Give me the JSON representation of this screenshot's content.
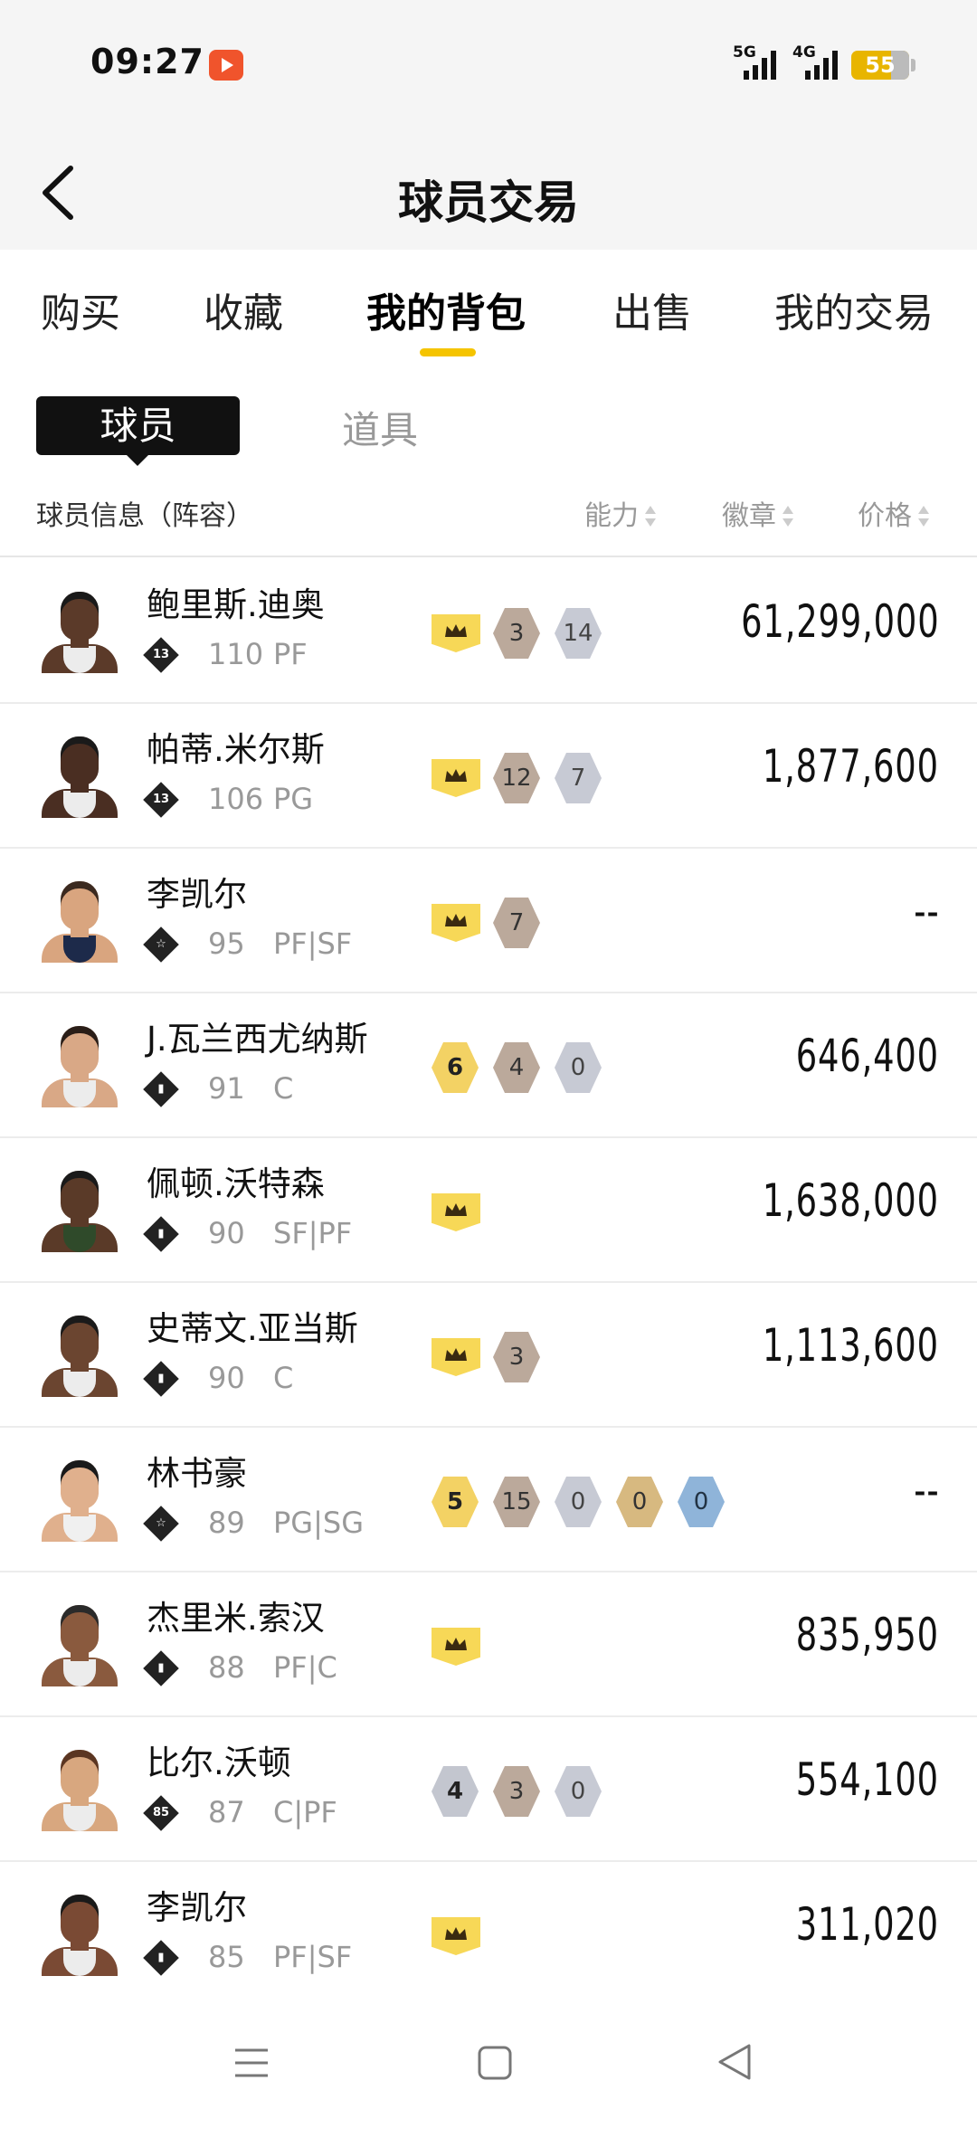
{
  "status_bar": {
    "time": "09:27",
    "sig1_label": "5G",
    "sig2_label": "4G",
    "battery": "55"
  },
  "header": {
    "title": "球员交易"
  },
  "tabs": [
    {
      "label": "购买"
    },
    {
      "label": "收藏"
    },
    {
      "label": "我的背包"
    },
    {
      "label": "出售"
    },
    {
      "label": "我的交易"
    }
  ],
  "segment": {
    "active": "球员",
    "other": "道具"
  },
  "columns": {
    "info": "球员信息（阵容）",
    "ability": "能力",
    "badge": "徽章",
    "price": "价格"
  },
  "players": [
    {
      "name": "鲍里斯.迪奥",
      "badge": "13",
      "rating": "110",
      "pos": "PF",
      "price": "61,299,000",
      "tags": [
        {
          "t": "crown",
          "v": ""
        },
        {
          "t": "bronze",
          "v": "3"
        },
        {
          "t": "silver",
          "v": "14"
        }
      ]
    },
    {
      "name": "帕蒂.米尔斯",
      "badge": "13",
      "rating": "106",
      "pos": "PG",
      "price": "1,877,600",
      "tags": [
        {
          "t": "crown",
          "v": ""
        },
        {
          "t": "bronze",
          "v": "12"
        },
        {
          "t": "silver",
          "v": "7"
        }
      ]
    },
    {
      "name": "李凯尔",
      "badge": "☆",
      "rating": "95",
      "pos": "PF|SF",
      "price": "--",
      "tags": [
        {
          "t": "crown",
          "v": ""
        },
        {
          "t": "bronze",
          "v": "7"
        }
      ]
    },
    {
      "name": "J.瓦兰西尤纳斯",
      "badge": "▮",
      "rating": "91",
      "pos": "C",
      "price": "646,400",
      "tags": [
        {
          "t": "gold",
          "v": "6"
        },
        {
          "t": "bronze",
          "v": "4"
        },
        {
          "t": "silver",
          "v": "0"
        }
      ]
    },
    {
      "name": "佩顿.沃特森",
      "badge": "▮",
      "rating": "90",
      "pos": "SF|PF",
      "price": "1,638,000",
      "tags": [
        {
          "t": "crown",
          "v": ""
        }
      ]
    },
    {
      "name": "史蒂文.亚当斯",
      "badge": "▮",
      "rating": "90",
      "pos": "C",
      "price": "1,113,600",
      "tags": [
        {
          "t": "crown",
          "v": ""
        },
        {
          "t": "bronze",
          "v": "3"
        }
      ]
    },
    {
      "name": "林书豪",
      "badge": "☆",
      "rating": "89",
      "pos": "PG|SG",
      "price": "--",
      "tags": [
        {
          "t": "gold",
          "v": "5"
        },
        {
          "t": "bronze",
          "v": "15"
        },
        {
          "t": "silver",
          "v": "0"
        },
        {
          "t": "goldb",
          "v": "0"
        },
        {
          "t": "blue",
          "v": "0"
        }
      ]
    },
    {
      "name": "杰里米.索汉",
      "badge": "▮",
      "rating": "88",
      "pos": "PF|C",
      "price": "835,950",
      "tags": [
        {
          "t": "crown",
          "v": ""
        }
      ]
    },
    {
      "name": "比尔.沃顿",
      "badge": "85",
      "rating": "87",
      "pos": "C|PF",
      "price": "554,100",
      "tags": [
        {
          "t": "silverlvl",
          "v": "4"
        },
        {
          "t": "bronze",
          "v": "3"
        },
        {
          "t": "silver",
          "v": "0"
        }
      ]
    },
    {
      "name": "李凯尔",
      "badge": "▮",
      "rating": "85",
      "pos": "PF|SF",
      "price": "311,020",
      "tags": [
        {
          "t": "crown",
          "v": ""
        }
      ]
    }
  ]
}
